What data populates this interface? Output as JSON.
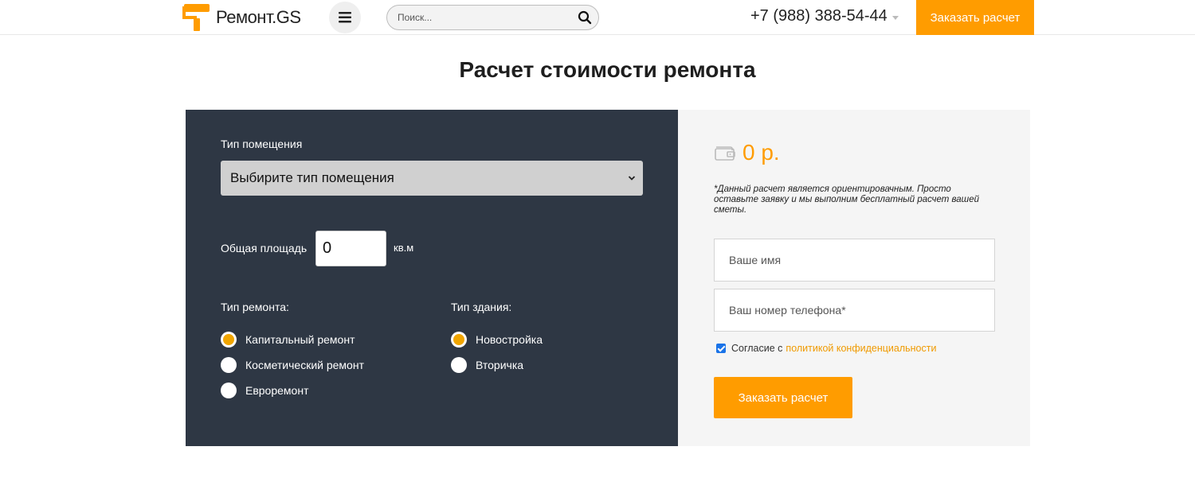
{
  "header": {
    "logo_text": "Ремонт.GS",
    "search_placeholder": "Поиск...",
    "phone": "+7 (988) 388-54-44",
    "order_button": "Заказать расчет"
  },
  "page": {
    "title": "Расчет стоимости ремонта"
  },
  "calculator": {
    "room_type_label": "Тип помещения",
    "room_type_selected": "Выбирите тип помещения",
    "area_label": "Общая площадь",
    "area_value": "0",
    "area_unit": "кв.м",
    "repair_type_label": "Тип ремонта:",
    "repair_types": [
      {
        "label": "Капитальный ремонт",
        "checked": true
      },
      {
        "label": "Косметический ремонт",
        "checked": false
      },
      {
        "label": "Евроремонт",
        "checked": false
      }
    ],
    "building_type_label": "Тип здания:",
    "building_types": [
      {
        "label": "Новостройка",
        "checked": true
      },
      {
        "label": "Вторичка",
        "checked": false
      }
    ]
  },
  "order_form": {
    "price": "0 р.",
    "disclaimer": "*Данный расчет является ориентировачным. Просто оставьте заявку и мы выполним бесплатный расчет вашей сметы.",
    "name_placeholder": "Ваше имя",
    "phone_placeholder": "Ваш номер телефона*",
    "consent_checked": true,
    "consent_text": "Согласие с",
    "consent_link": "политикой конфиденциальности",
    "submit_button": "Заказать расчет"
  },
  "colors": {
    "accent": "#ff9c00",
    "panel_dark": "#2e3744",
    "panel_light": "#f5f5f5"
  }
}
